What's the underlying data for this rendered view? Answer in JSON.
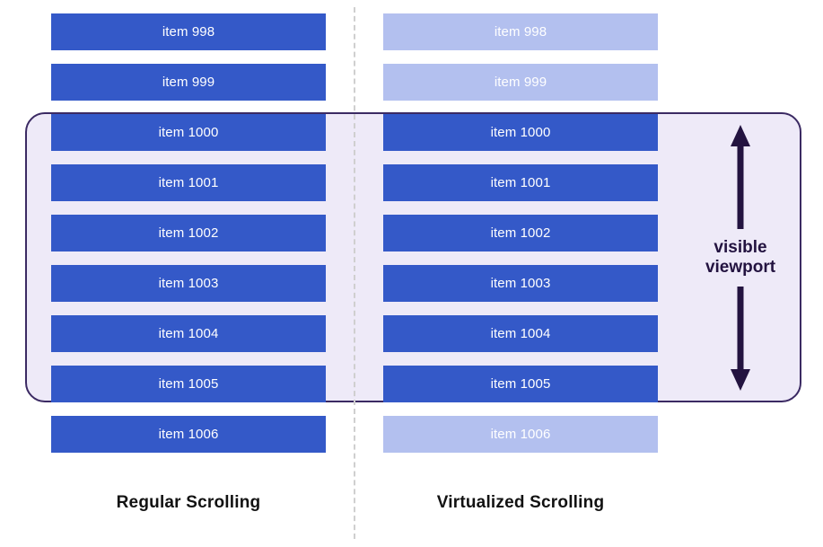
{
  "diagram": {
    "title_left": "Regular Scrolling",
    "title_right": "Virtualized Scrolling",
    "viewport_label_line1": "visible",
    "viewport_label_line2": "viewport",
    "colors": {
      "solid_item": "#3459c8",
      "faded_item": "#b3c0ef",
      "viewport_fill": "#eeeaf8",
      "viewport_border": "#3b2a63",
      "divider": "#cfcfcf",
      "item_text": "#ffffff",
      "caption_text": "#121212",
      "annotation_text": "#231340"
    }
  },
  "left_column": {
    "name": "Regular Scrolling",
    "items": [
      {
        "label": "item 998",
        "state": "solid"
      },
      {
        "label": "item 999",
        "state": "solid"
      },
      {
        "label": "item 1000",
        "state": "solid"
      },
      {
        "label": "item 1001",
        "state": "solid"
      },
      {
        "label": "item 1002",
        "state": "solid"
      },
      {
        "label": "item 1003",
        "state": "solid"
      },
      {
        "label": "item 1004",
        "state": "solid"
      },
      {
        "label": "item 1005",
        "state": "solid"
      },
      {
        "label": "item 1006",
        "state": "solid"
      }
    ]
  },
  "right_column": {
    "name": "Virtualized Scrolling",
    "items": [
      {
        "label": "item 998",
        "state": "faded"
      },
      {
        "label": "item 999",
        "state": "faded"
      },
      {
        "label": "item 1000",
        "state": "solid"
      },
      {
        "label": "item 1001",
        "state": "solid"
      },
      {
        "label": "item 1002",
        "state": "solid"
      },
      {
        "label": "item 1003",
        "state": "solid"
      },
      {
        "label": "item 1004",
        "state": "solid"
      },
      {
        "label": "item 1005",
        "state": "solid"
      },
      {
        "label": "item 1006",
        "state": "faded"
      }
    ]
  },
  "icons": {
    "arrow_up": "arrow-up-icon",
    "arrow_down": "arrow-down-icon"
  }
}
